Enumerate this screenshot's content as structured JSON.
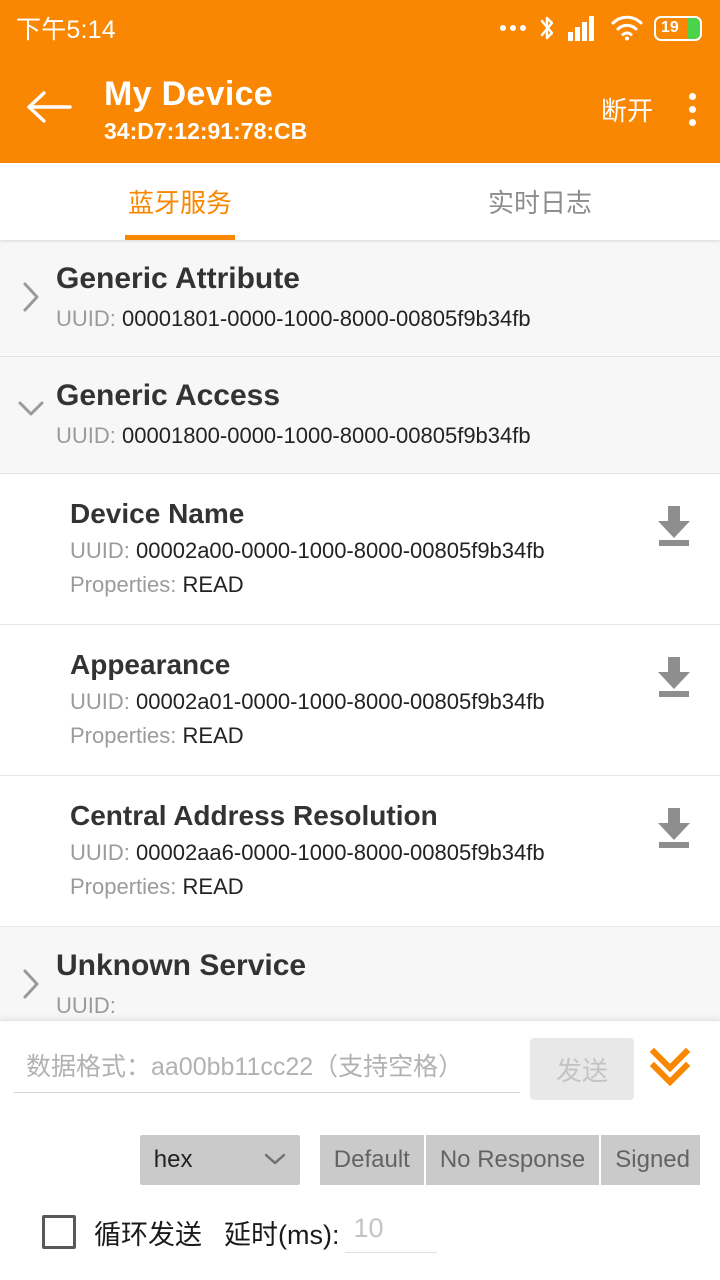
{
  "statusbar": {
    "time": "下午5:14",
    "icons": [
      "more-dots-icon",
      "bluetooth-icon",
      "signal-icon",
      "wifi-icon",
      "battery-icon"
    ],
    "battery_level": "19"
  },
  "appbar": {
    "back_icon": "back-arrow-icon",
    "title": "My Device",
    "subtitle": "34:D7:12:91:78:CB",
    "disconnect_label": "断开",
    "overflow_icon": "kebab-menu-icon",
    "accent_color": "#F98701"
  },
  "tabs": [
    {
      "label": "蓝牙服务",
      "active": true
    },
    {
      "label": "实时日志",
      "active": false
    }
  ],
  "services": [
    {
      "name": "Generic Attribute",
      "uuid_label": "UUID:",
      "uuid": "00001801-0000-1000-8000-00805f9b34fb",
      "expanded": false,
      "characteristics": []
    },
    {
      "name": "Generic Access",
      "uuid_label": "UUID:",
      "uuid": "00001800-0000-1000-8000-00805f9b34fb",
      "expanded": true,
      "characteristics": [
        {
          "name": "Device Name",
          "uuid_label": "UUID:",
          "uuid": "00002a00-0000-1000-8000-00805f9b34fb",
          "properties_label": "Properties:",
          "properties": "READ",
          "action_icon": "download-icon"
        },
        {
          "name": "Appearance",
          "uuid_label": "UUID:",
          "uuid": "00002a01-0000-1000-8000-00805f9b34fb",
          "properties_label": "Properties:",
          "properties": "READ",
          "action_icon": "download-icon"
        },
        {
          "name": "Central Address Resolution",
          "uuid_label": "UUID:",
          "uuid": "00002aa6-0000-1000-8000-00805f9b34fb",
          "properties_label": "Properties:",
          "properties": "READ",
          "action_icon": "download-icon"
        }
      ]
    },
    {
      "name": "Unknown Service",
      "uuid_label": "UUID:",
      "uuid": "",
      "expanded": false,
      "characteristics": []
    }
  ],
  "bottom_panel": {
    "data_input_placeholder": "数据格式：aa00bb11cc22（支持空格）",
    "data_input_value": "",
    "send_label": "发送",
    "send_disabled": true,
    "expand_icon": "double-chevron-down-icon",
    "format_select": {
      "value": "hex",
      "chevron_icon": "chevron-down-icon"
    },
    "write_modes": [
      "Default",
      "No Response",
      "Signed"
    ],
    "loop_checkbox_label": "循环发送",
    "loop_checked": false,
    "delay_label": "延时(ms):",
    "delay_placeholder": "10",
    "delay_value": ""
  }
}
